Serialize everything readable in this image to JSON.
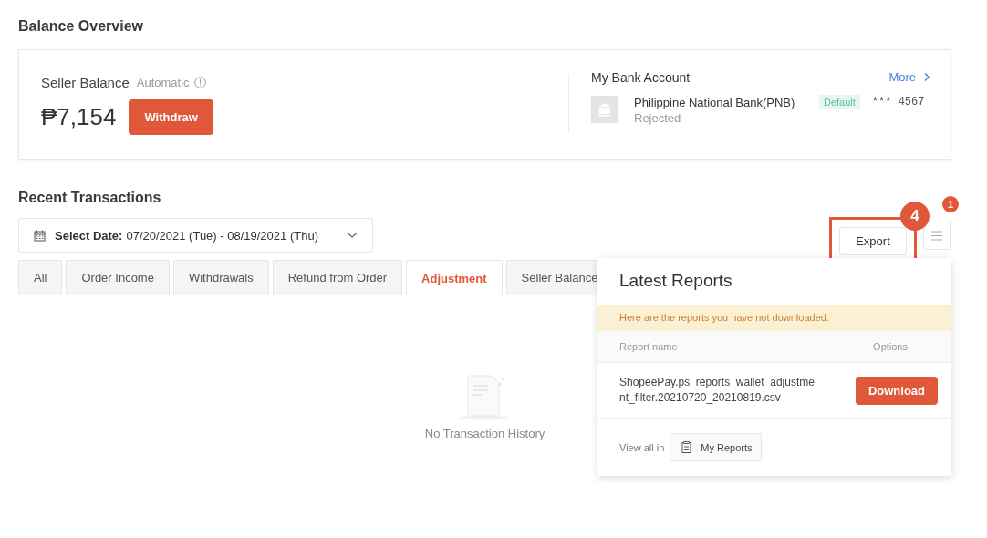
{
  "page_title": "Balance Overview",
  "balance": {
    "label": "Seller Balance",
    "mode": "Automatic",
    "amount": "₱7,154",
    "button": "Withdraw"
  },
  "bank": {
    "title": "My Bank Account",
    "more": "More",
    "name": "Philippine National Bank(PNB)",
    "status": "Rejected",
    "tag": "Default",
    "account": "*** 4567"
  },
  "transactions": {
    "title": "Recent Transactions",
    "date_label": "Select Date:",
    "date_value": "07/20/2021 (Tue) - 08/19/2021 (Thu)",
    "tabs": [
      {
        "label": "All",
        "selected": false
      },
      {
        "label": "Order Income",
        "selected": false
      },
      {
        "label": "Withdrawals",
        "selected": false
      },
      {
        "label": "Refund from Order",
        "selected": false
      },
      {
        "label": "Adjustment",
        "selected": true
      },
      {
        "label": "Seller Balance",
        "selected": false
      }
    ],
    "empty": "No Transaction History",
    "export": "Export",
    "step_badge": "4",
    "menu_badge": "1"
  },
  "reports_popover": {
    "title": "Latest Reports",
    "notice": "Here are the reports you have not downloaded.",
    "columns": [
      "Report name",
      "Options"
    ],
    "rows": [
      {
        "name": "ShopeePay.ps_reports_wallet_adjustment_filter.20210720_20210819.csv",
        "action": "Download"
      }
    ],
    "footer_label": "View all in",
    "footer_button": "My Reports"
  }
}
